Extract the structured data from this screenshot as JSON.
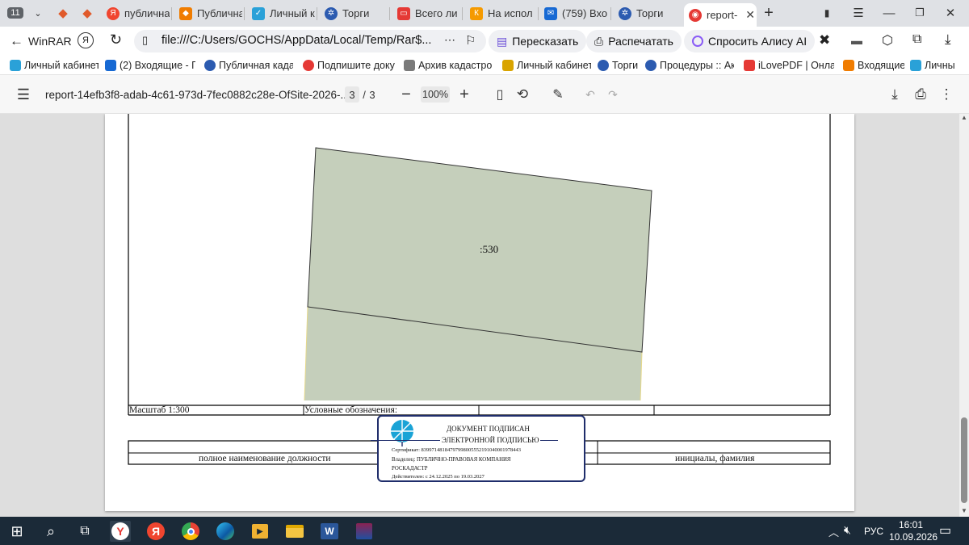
{
  "tabs": {
    "group_count": "11",
    "items": [
      {
        "label": "публична",
        "fav_color": "#f0452f"
      },
      {
        "label": "Публична",
        "fav_color": "#f07c00"
      },
      {
        "label": "Личный к",
        "fav_color": "#2aa1d8"
      },
      {
        "label": "Торги",
        "fav_color": "#2c5bb0"
      },
      {
        "label": "Всего ли",
        "fav_color": "#e53935"
      },
      {
        "label": "На испол",
        "fav_color": "#f59a00"
      },
      {
        "label": "(759) Вхо",
        "fav_color": "#1769d3"
      },
      {
        "label": "Торги",
        "fav_color": "#2c5bb0"
      },
      {
        "label": "report-",
        "fav_color": "#e53935"
      }
    ]
  },
  "address": {
    "back_label": "WinRAR",
    "url": "file:///C:/Users/GOCHS/AppData/Local/Temp/Rar$...",
    "retell_label": "Пересказать",
    "print_label": "Распечатать",
    "alice_label": "Спросить Алису AI"
  },
  "bookmarks": [
    {
      "label": "Личный кабинет",
      "color": "#2aa1d8"
    },
    {
      "label": "(2) Входящие - Пс",
      "color": "#1769d3"
    },
    {
      "label": "Публичная кадас",
      "color": "#2c5bb0"
    },
    {
      "label": "Подпишите доку",
      "color": "#e53935"
    },
    {
      "label": "Архив кадастров",
      "color": "#7a7a7a"
    },
    {
      "label": "Личный кабинет",
      "color": "#d9a400"
    },
    {
      "label": "Торги",
      "color": "#2c5bb0"
    },
    {
      "label": "Процедуры :: Акт",
      "color": "#2c5bb0"
    },
    {
      "label": "iLovePDF | Онлай",
      "color": "#e53935"
    },
    {
      "label": "Входящие",
      "color": "#f07c00"
    },
    {
      "label": "Личны",
      "color": "#2aa1d8"
    }
  ],
  "pdf_toolbar": {
    "filename": "report-14efb3f8-adab-4c61-973d-7fec0882c28e-OfSite-2026-...",
    "current_page": "3",
    "page_sep": "/",
    "total_pages": "3",
    "zoom": "100%"
  },
  "document": {
    "parcel_label": ":530",
    "scale": "Масштаб 1:300",
    "legend_title": "Условные обозначения:",
    "position_caption": "полное наименование должности",
    "name_caption": "инициалы, фамилия",
    "parcel_fill": "#c5cfbb",
    "stamp": {
      "line1": "ДОКУМЕНТ ПОДПИСАН",
      "line2": "ЭЛЕКТРОННОЙ ПОДПИСЬЮ",
      "certificate": "Сертификат: 83997148184797998005552191040001978443",
      "owner": "Владелец: ПУБЛИЧНО-ПРАВОВАЯ КОМПАНИЯ",
      "owner2": "РОСКАДАСТР",
      "validity": "Действителен: с 24.12.2025 по 19.03.2027",
      "border_color": "#1f2d6b"
    }
  },
  "taskbar": {
    "lang": "РУС",
    "time": "16:01",
    "date": "10.09.2026"
  }
}
